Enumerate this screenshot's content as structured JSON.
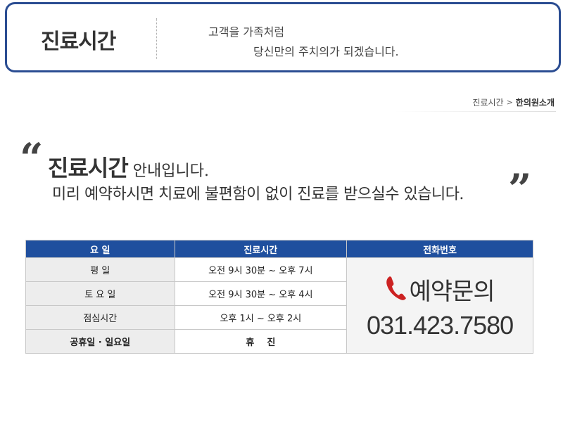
{
  "header": {
    "title": "진료시간",
    "slogan_line1": "고객을 가족처럼",
    "slogan_line2": "당신만의 주치의가 되겠습니다."
  },
  "breadcrumb": {
    "item": "진료시간",
    "separator": ">",
    "current": "한의원소개"
  },
  "intro": {
    "open_quote": "“",
    "close_quote": "”",
    "title_strong": "진료시간",
    "title_rest": " 안내입니다.",
    "subtitle": "미리 예약하시면 치료에 불편함이 없이 진료를 받으실수 있습니다."
  },
  "table": {
    "headers": [
      "요  일",
      "진료시간",
      "전화번호"
    ],
    "rows": [
      {
        "day": "평  일",
        "time": "오전 9시 30분 ~ 오후 7시"
      },
      {
        "day": "토 요 일",
        "time": "오전 9시 30분 ~ 오후 4시"
      },
      {
        "day": "점심시간",
        "time": "오후 1시 ~ 오후 2시"
      },
      {
        "day": "공휴일 · 일요일",
        "time": "휴    진"
      }
    ],
    "contact": {
      "label": "예약문의",
      "phone": "031.423.7580",
      "icon": "phone-icon"
    }
  },
  "colors": {
    "accent": "#2b4d92",
    "header_bg": "#1f4f9e",
    "holiday": "#e02020",
    "phone_icon": "#cc2222"
  }
}
